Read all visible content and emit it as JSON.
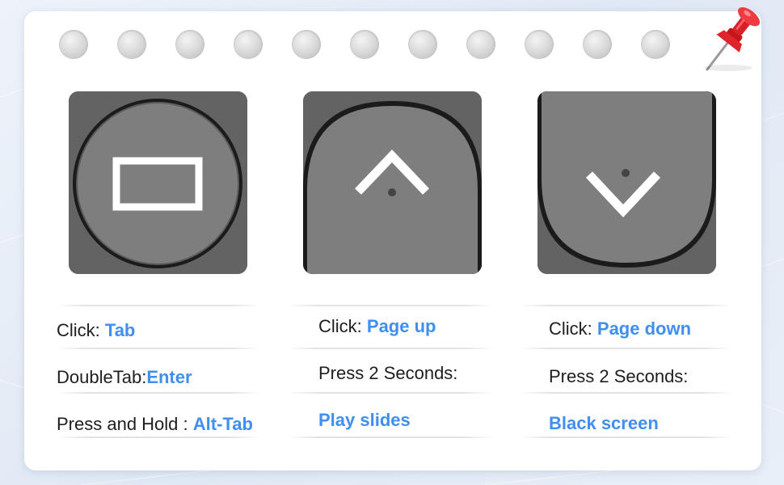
{
  "colors": {
    "accent": "#3f8ef0",
    "key_face": "#7e7e7e",
    "key_bg": "#636363",
    "pin": "#e0242c"
  },
  "keys": [
    {
      "icon": "rectangle-icon",
      "name": "tab-key"
    },
    {
      "icon": "chevron-up-icon",
      "name": "page-up-key"
    },
    {
      "icon": "chevron-down-icon",
      "name": "page-down-key"
    }
  ],
  "columns": [
    {
      "rows": [
        {
          "label": "Click: ",
          "value": "Tab"
        },
        {
          "label": "DoubleTab:",
          "value": "Enter"
        },
        {
          "label": "Press and Hold : ",
          "value": "Alt-Tab"
        }
      ]
    },
    {
      "rows": [
        {
          "label": "Click: ",
          "value": "Page up"
        },
        {
          "label": "Press 2 Seconds:",
          "value": ""
        },
        {
          "label": "",
          "value": "Play slides"
        }
      ]
    },
    {
      "rows": [
        {
          "label": "Click: ",
          "value": "Page down"
        },
        {
          "label": "Press 2 Seconds:",
          "value": ""
        },
        {
          "label": "",
          "value": "Black screen"
        }
      ]
    }
  ]
}
